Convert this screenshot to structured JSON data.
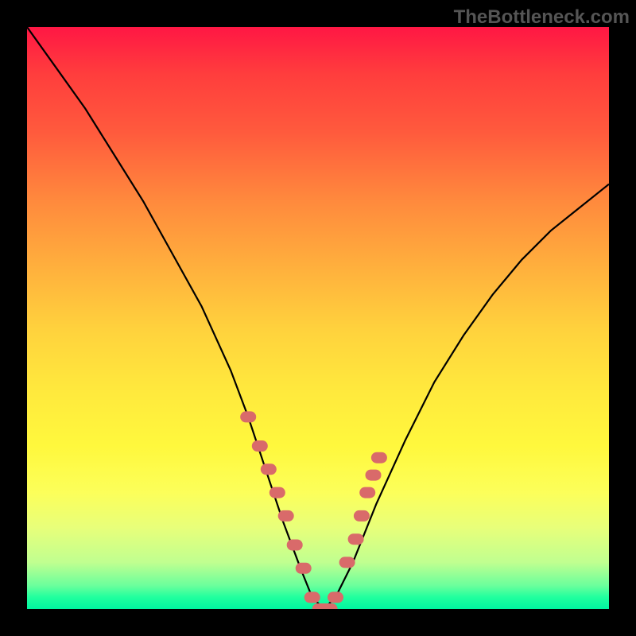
{
  "watermark": "TheBottleneck.com",
  "chart_data": {
    "type": "line",
    "title": "",
    "xlabel": "",
    "ylabel": "",
    "xlim": [
      0,
      100
    ],
    "ylim": [
      0,
      100
    ],
    "series": [
      {
        "name": "curve",
        "x": [
          0,
          5,
          10,
          15,
          20,
          25,
          30,
          35,
          38,
          41,
          44,
          47,
          49,
          51,
          53,
          56,
          60,
          65,
          70,
          75,
          80,
          85,
          90,
          95,
          100
        ],
        "values": [
          100,
          93,
          86,
          78,
          70,
          61,
          52,
          41,
          33,
          24,
          15,
          7,
          2,
          0,
          2,
          8,
          18,
          29,
          39,
          47,
          54,
          60,
          65,
          69,
          73
        ]
      }
    ],
    "points": {
      "name": "markers",
      "x": [
        38,
        40,
        41.5,
        43,
        44.5,
        46,
        47.5,
        49,
        51,
        52,
        53,
        55,
        56.5,
        57.5,
        58.5,
        59.5,
        60.5
      ],
      "values": [
        33,
        28,
        24,
        20,
        16,
        11,
        7,
        2,
        0,
        0,
        2,
        8,
        12,
        16,
        20,
        23,
        26
      ]
    },
    "colors": {
      "curve": "#000000",
      "markers": "#d96a6a",
      "background_top": "#ff1744",
      "background_bottom": "#00f5a0"
    }
  }
}
